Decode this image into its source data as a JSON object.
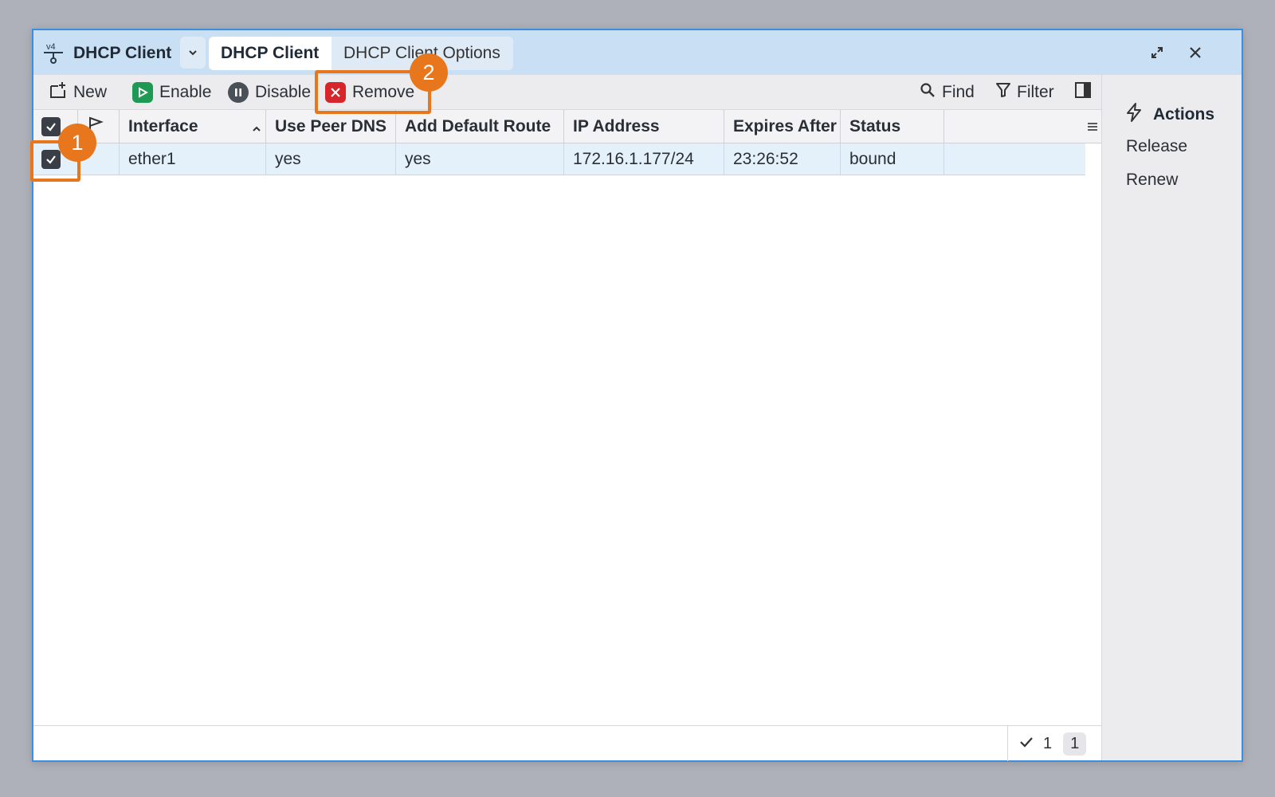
{
  "window": {
    "title": "DHCP Client",
    "tabs": [
      {
        "label": "DHCP Client",
        "active": true
      },
      {
        "label": "DHCP Client Options",
        "active": false
      }
    ]
  },
  "toolbar": {
    "new_label": "New",
    "enable_label": "Enable",
    "disable_label": "Disable",
    "remove_label": "Remove",
    "find_label": "Find",
    "filter_label": "Filter"
  },
  "table": {
    "columns": [
      "Interface",
      "Use Peer DNS",
      "Add Default Route",
      "IP Address",
      "Expires After",
      "Status"
    ],
    "sort_column": "Interface",
    "rows": [
      {
        "selected": true,
        "interface": "ether1",
        "use_peer_dns": "yes",
        "add_default_route": "yes",
        "ip_address": "172.16.1.177/24",
        "expires_after": "23:26:52",
        "status": "bound"
      }
    ]
  },
  "status_bar": {
    "selected_count": "1",
    "total_count": "1"
  },
  "actions_panel": {
    "title": "Actions",
    "items": [
      "Release",
      "Renew"
    ]
  },
  "callouts": [
    "1",
    "2"
  ],
  "colors": {
    "titlebar": "#c9e0f4",
    "accent_border": "#3b8fe0",
    "enable": "#1e9a55",
    "remove": "#d7262b",
    "callout": "#e8761c",
    "selected_row": "#e4f0fa"
  }
}
